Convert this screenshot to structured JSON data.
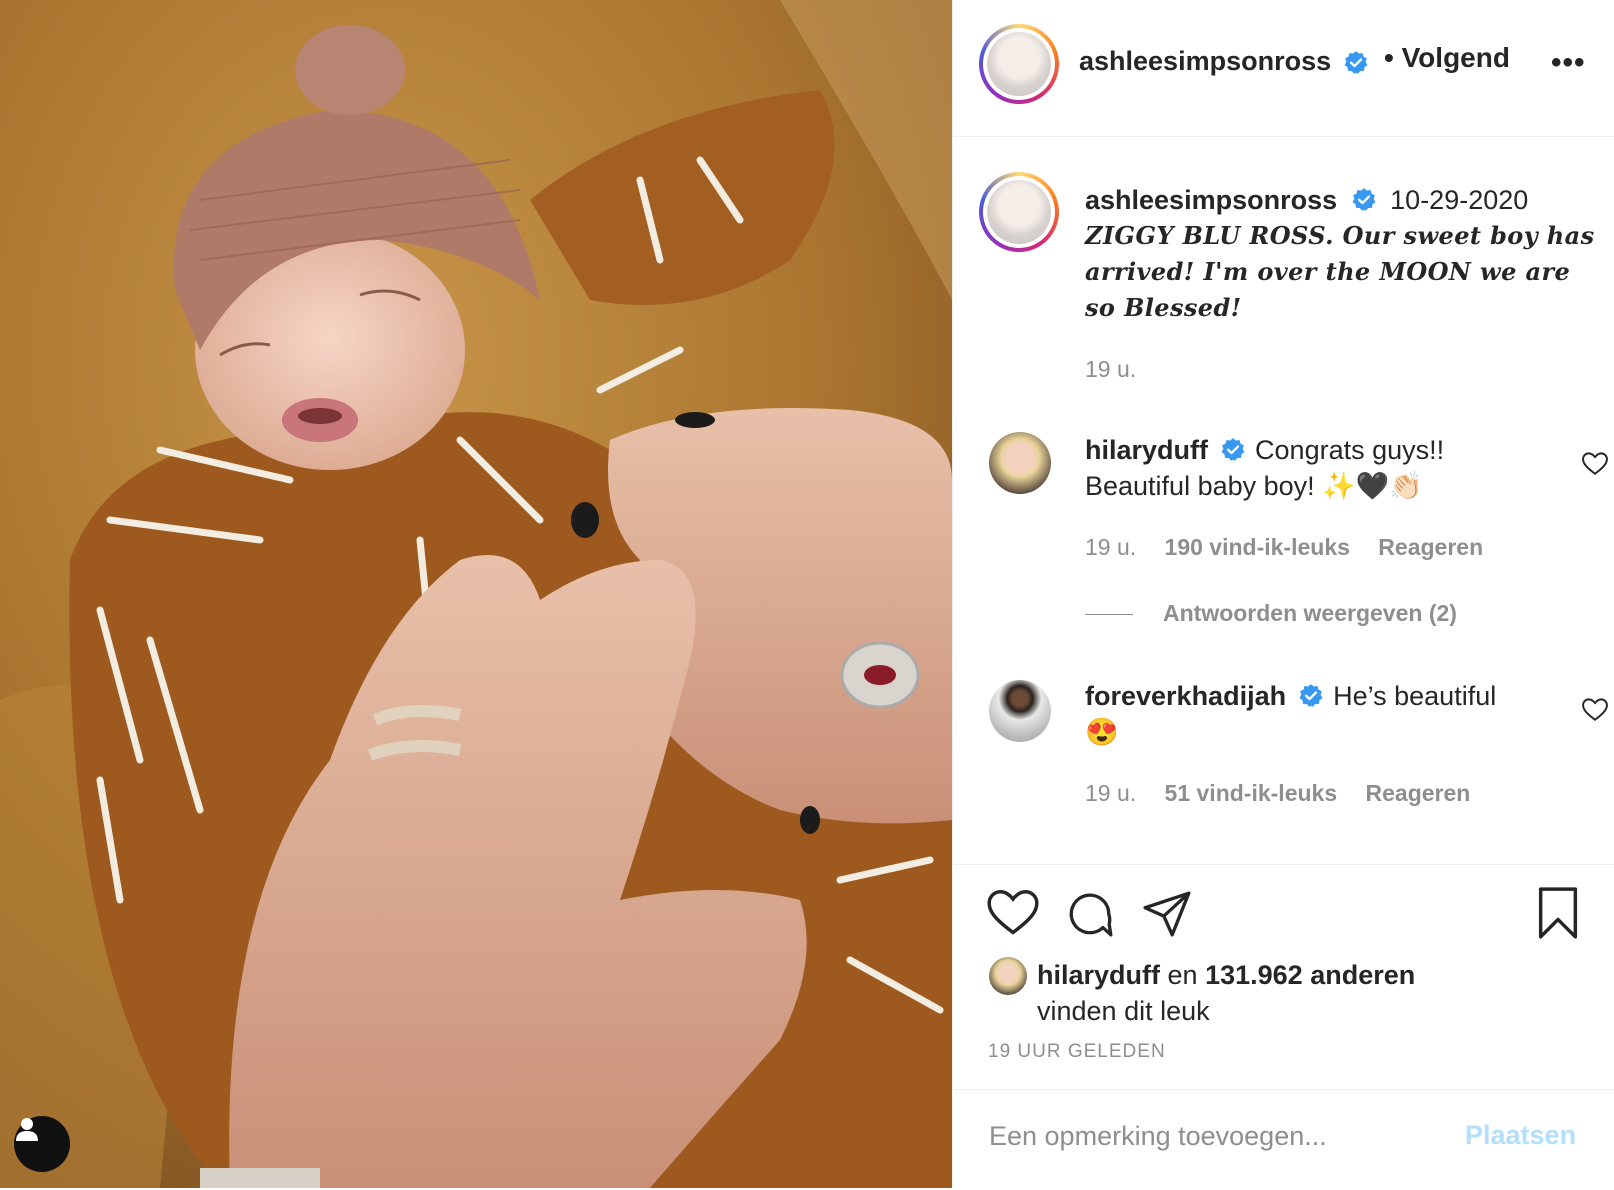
{
  "header": {
    "username": "ashleesimpsonross",
    "follow_label": "• Volgend",
    "more_label": "•••"
  },
  "caption": {
    "username": "ashleesimpsonross",
    "date": "10-29-2020",
    "text": "ZIGGY BLU ROSS. Our sweet boy has arrived! I'm over the MOON we are so Blessed!",
    "time": "19 u."
  },
  "comments": [
    {
      "username": "hilaryduff",
      "text": "Congrats guys!! Beautiful baby boy! ✨🖤👏🏻",
      "time": "19 u.",
      "likes": "190 vind-ik-leuks",
      "reply_label": "Reageren",
      "view_replies": "Antwoorden weergeven (2)"
    },
    {
      "username": "foreverkhadijah",
      "text": "He’s beautiful 😍",
      "time": "19 u.",
      "likes": "51 vind-ik-leuks",
      "reply_label": "Reageren"
    }
  ],
  "likes_summary": {
    "user": "hilaryduff",
    "en": "en",
    "others": "131.962 anderen",
    "suffix": "vinden dit leuk"
  },
  "posted_ago": "19 UUR GELEDEN",
  "comment_form": {
    "placeholder": "Een opmerking toevoegen...",
    "post_label": "Plaatsen"
  },
  "colors": {
    "verified": "#3897f0",
    "post_button": "#b2dffc",
    "secondary_text": "#8e8e8e"
  },
  "icons": [
    "user-tag-icon",
    "verified-icon",
    "heart-icon",
    "comment-icon",
    "share-icon",
    "bookmark-icon"
  ]
}
